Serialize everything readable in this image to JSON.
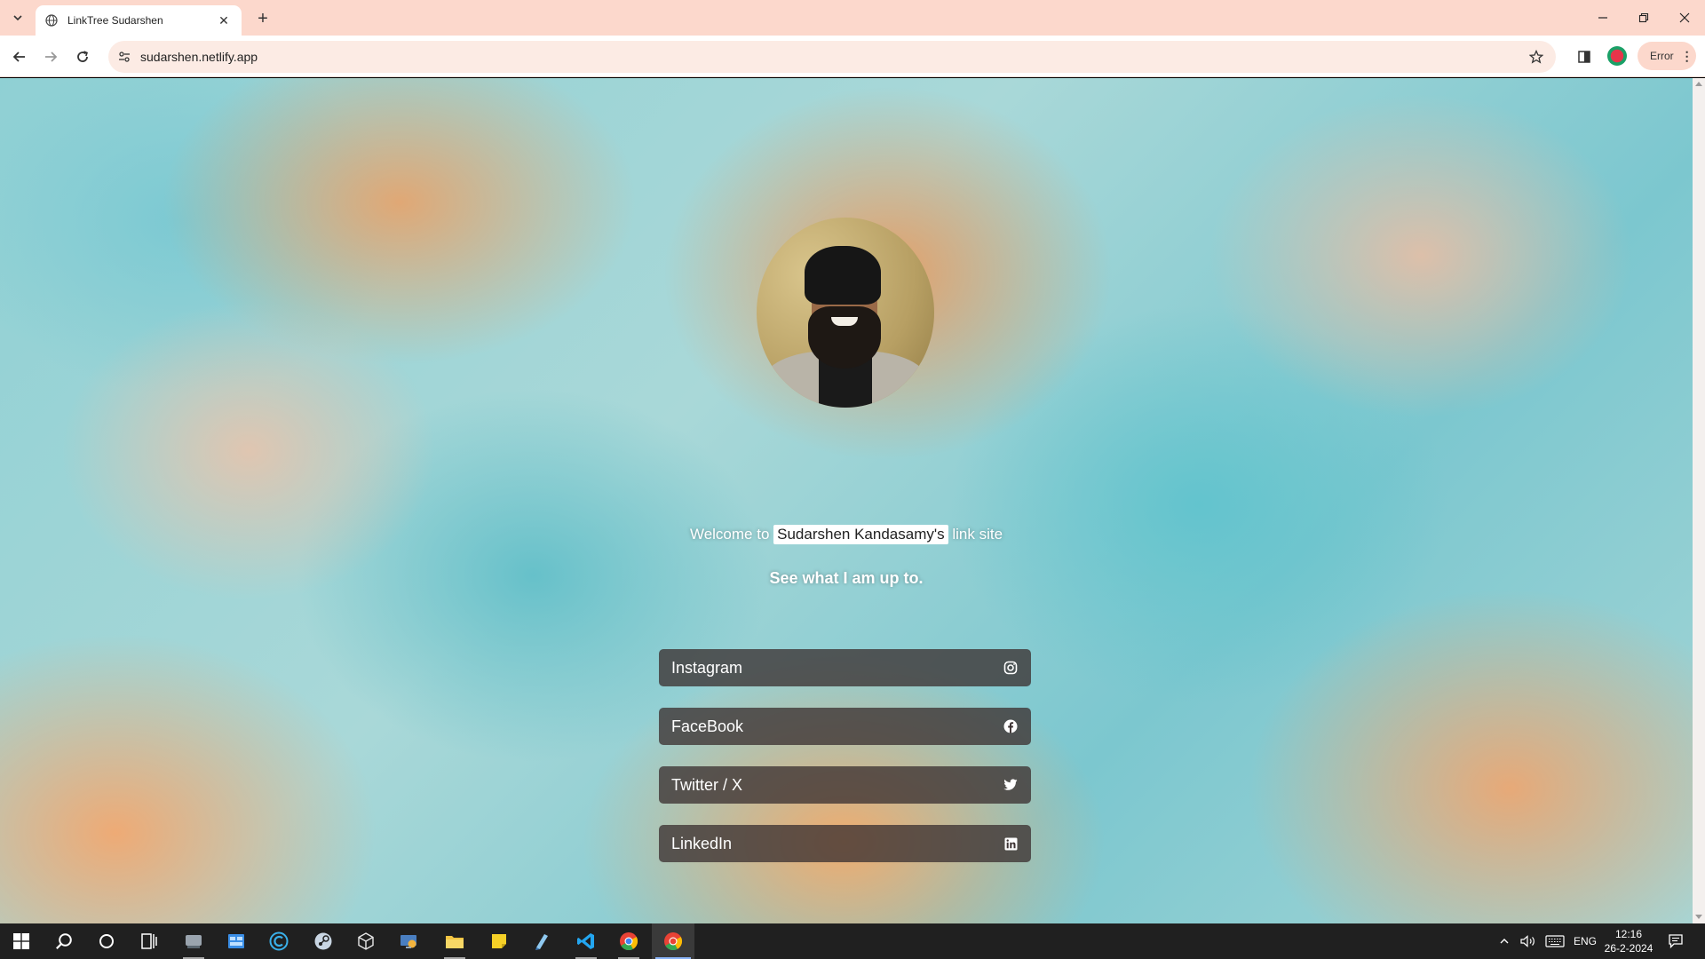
{
  "browser": {
    "tab_title": "LinkTree Sudarshen",
    "url": "sudarshen.netlify.app",
    "error_label": "Error",
    "new_tab_symbol": "+"
  },
  "page": {
    "welcome_prefix": "Welcome to",
    "welcome_name": "Sudarshen Kandasamy's",
    "welcome_suffix": "link site",
    "tagline": "See what I am up to.",
    "links": [
      {
        "label": "Instagram",
        "icon": "instagram-icon"
      },
      {
        "label": "FaceBook",
        "icon": "facebook-icon"
      },
      {
        "label": "Twitter / X",
        "icon": "twitter-icon"
      },
      {
        "label": "LinkedIn",
        "icon": "linkedin-icon"
      }
    ]
  },
  "taskbar": {
    "language": "ENG",
    "time": "12:16",
    "date": "26-2-2024"
  },
  "colors": {
    "tabbar_bg": "#fcd8cc",
    "button_bg": "#3c3232",
    "accent": "#8ab4f8"
  }
}
